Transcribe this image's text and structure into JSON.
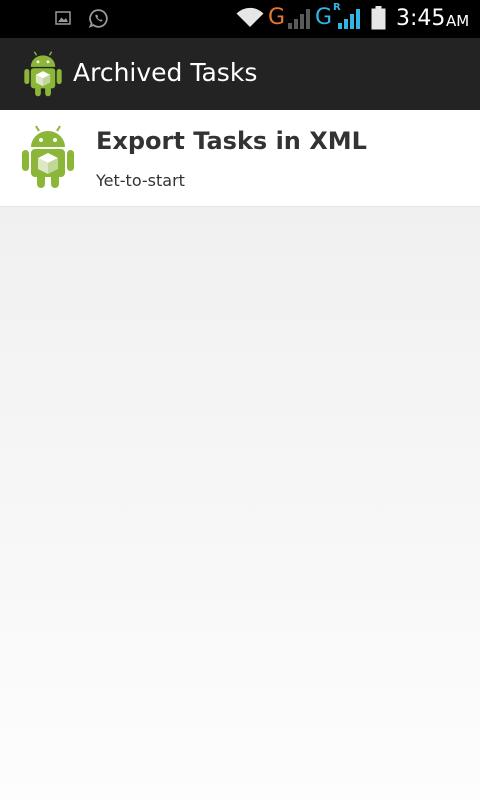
{
  "status_bar": {
    "network_1": "G",
    "network_2": "G",
    "roaming": "R",
    "time": "3:45",
    "ampm": "AM",
    "colors": {
      "network_1": "#e8772e",
      "network_2": "#33b5e5"
    },
    "icons": [
      "gallery-icon",
      "whatsapp-icon",
      "wifi-icon",
      "signal-icon",
      "signal-icon",
      "battery-icon"
    ]
  },
  "action_bar": {
    "title": "Archived Tasks",
    "icon": "android-app-icon"
  },
  "tasks": [
    {
      "title": "Export Tasks in XML",
      "status": "Yet-to-start",
      "icon": "android-app-icon"
    }
  ],
  "colors": {
    "action_bar": "#232323",
    "status_bar": "#000000",
    "android_green": "#8cb638"
  }
}
